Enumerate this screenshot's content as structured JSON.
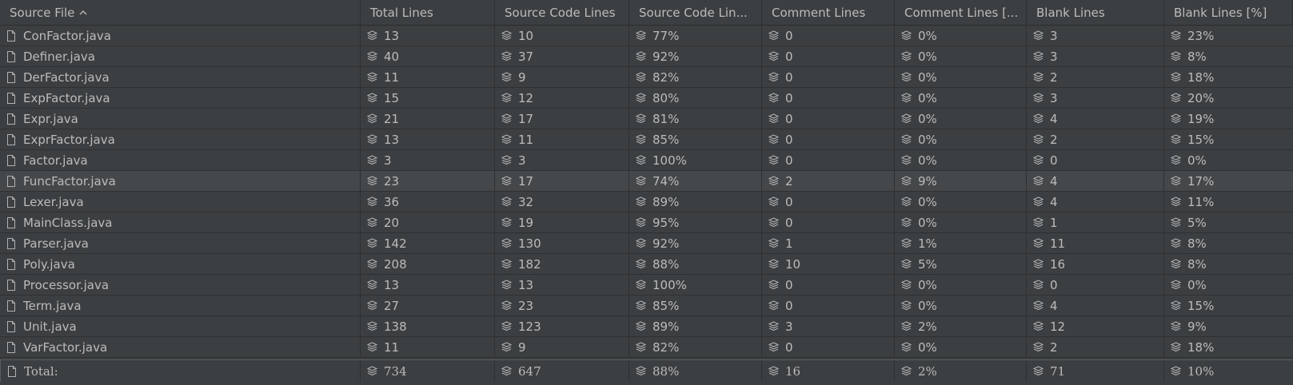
{
  "headers": [
    "Source File",
    "Total Lines",
    "Source Code Lines",
    "Source Code Lin...",
    "Comment Lines",
    "Comment Lines [...",
    "Blank Lines",
    "Blank Lines [%]"
  ],
  "sort_indicator_icon": "chevron-up-icon",
  "row_icons": {
    "file": "file-icon",
    "metric": "layers-icon"
  },
  "rows": [
    [
      "ConFactor.java",
      "13",
      "10",
      "77%",
      "0",
      "0%",
      "3",
      "23%"
    ],
    [
      "Definer.java",
      "40",
      "37",
      "92%",
      "0",
      "0%",
      "3",
      "8%"
    ],
    [
      "DerFactor.java",
      "11",
      "9",
      "82%",
      "0",
      "0%",
      "2",
      "18%"
    ],
    [
      "ExpFactor.java",
      "15",
      "12",
      "80%",
      "0",
      "0%",
      "3",
      "20%"
    ],
    [
      "Expr.java",
      "21",
      "17",
      "81%",
      "0",
      "0%",
      "4",
      "19%"
    ],
    [
      "ExprFactor.java",
      "13",
      "11",
      "85%",
      "0",
      "0%",
      "2",
      "15%"
    ],
    [
      "Factor.java",
      "3",
      "3",
      "100%",
      "0",
      "0%",
      "0",
      "0%"
    ],
    [
      "FuncFactor.java",
      "23",
      "17",
      "74%",
      "2",
      "9%",
      "4",
      "17%"
    ],
    [
      "Lexer.java",
      "36",
      "32",
      "89%",
      "0",
      "0%",
      "4",
      "11%"
    ],
    [
      "MainClass.java",
      "20",
      "19",
      "95%",
      "0",
      "0%",
      "1",
      "5%"
    ],
    [
      "Parser.java",
      "142",
      "130",
      "92%",
      "1",
      "1%",
      "11",
      "8%"
    ],
    [
      "Poly.java",
      "208",
      "182",
      "88%",
      "10",
      "5%",
      "16",
      "8%"
    ],
    [
      "Processor.java",
      "13",
      "13",
      "100%",
      "0",
      "0%",
      "0",
      "0%"
    ],
    [
      "Term.java",
      "27",
      "23",
      "85%",
      "0",
      "0%",
      "4",
      "15%"
    ],
    [
      "Unit.java",
      "138",
      "123",
      "89%",
      "3",
      "2%",
      "12",
      "9%"
    ],
    [
      "VarFactor.java",
      "11",
      "9",
      "82%",
      "0",
      "0%",
      "2",
      "18%"
    ]
  ],
  "highlighted_row": 7,
  "total": [
    "Total:",
    "734",
    "647",
    "88%",
    "16",
    "2%",
    "71",
    "10%"
  ],
  "colors": {
    "background": "#3c3f41",
    "highlight": "#45484a",
    "text": "#bbbbbb",
    "grid": "#2e3032"
  }
}
